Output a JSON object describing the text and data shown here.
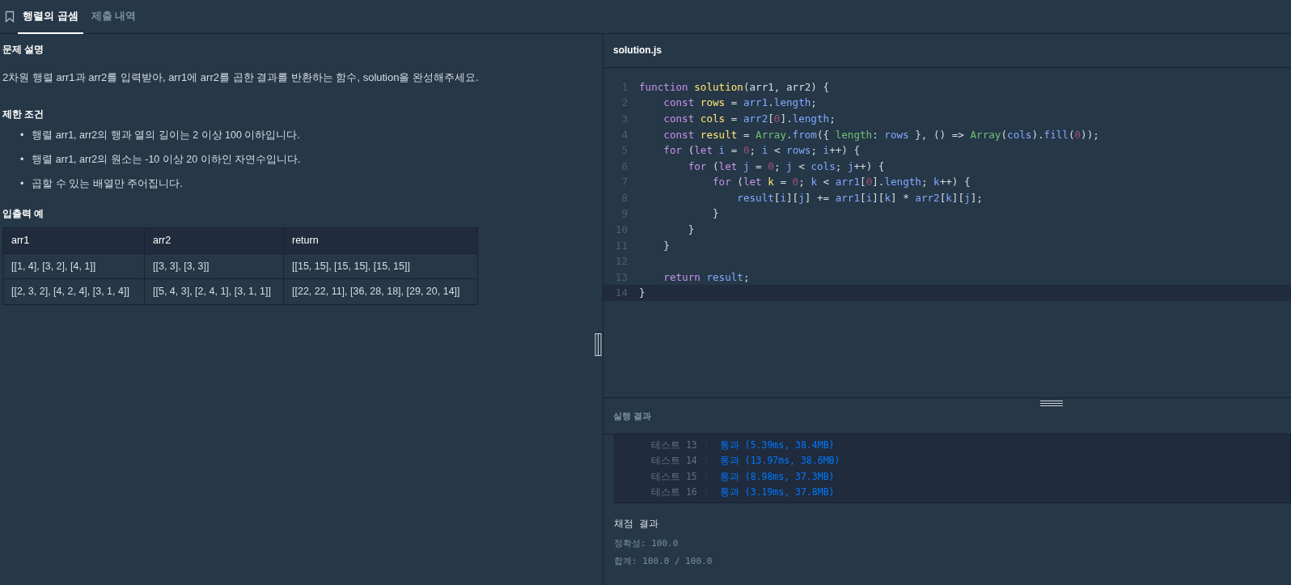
{
  "tabs": [
    {
      "label": "행렬의 곱셈",
      "selected": true
    },
    {
      "label": "제출 내역",
      "selected": false
    }
  ],
  "description": {
    "heading": "문제 설명",
    "text": "2차원 행렬 arr1과 arr2를 입력받아, arr1에 arr2를 곱한 결과를 반환하는 함수, solution을 완성해주세요."
  },
  "constraints": {
    "heading": "제한 조건",
    "items": [
      {
        "marker": "•",
        "text": "행렬 arr1, arr2의 행과 열의 길이는 2 이상 100 이하입니다."
      },
      {
        "marker": "•",
        "text": "행렬 arr1, arr2의 원소는 -10 이상 20 이하인 자연수입니다."
      },
      {
        "marker": "•",
        "text": "곱할 수 있는 배열만 주어집니다."
      }
    ]
  },
  "examples": {
    "heading": "입출력 예",
    "columns": [
      "arr1",
      "arr2",
      "return"
    ],
    "rows": [
      [
        "[[1, 4], [3, 2], [4, 1]]",
        "[[3, 3], [3, 3]]",
        "[[15, 15], [15, 15], [15, 15]]"
      ],
      [
        "[[2, 3, 2], [4, 2, 4], [3, 1, 4]]",
        "[[5, 4, 3], [2, 4, 1], [3, 1, 1]]",
        "[[22, 22, 11], [36, 28, 18], [29, 20, 14]]"
      ]
    ]
  },
  "editor": {
    "filename": "solution.js",
    "lines": [
      {
        "number": "1",
        "current": false,
        "tokens": [
          {
            "kind": "kw",
            "text": "function "
          },
          {
            "kind": "def",
            "text": "solution"
          },
          {
            "kind": "p",
            "text": "(arr1, arr2) {"
          }
        ]
      },
      {
        "number": "2",
        "current": false,
        "tokens": [
          {
            "kind": "kw",
            "text": "    const "
          },
          {
            "kind": "def",
            "text": "rows"
          },
          {
            "kind": "p",
            "text": " = "
          },
          {
            "kind": "var",
            "text": "arr1"
          },
          {
            "kind": "p",
            "text": "."
          },
          {
            "kind": "var",
            "text": "length"
          },
          {
            "kind": "p",
            "text": ";"
          }
        ]
      },
      {
        "number": "3",
        "current": false,
        "tokens": [
          {
            "kind": "kw",
            "text": "    const "
          },
          {
            "kind": "def",
            "text": "cols"
          },
          {
            "kind": "p",
            "text": " = "
          },
          {
            "kind": "var",
            "text": "arr2"
          },
          {
            "kind": "p",
            "text": "["
          },
          {
            "kind": "num",
            "text": "0"
          },
          {
            "kind": "p",
            "text": "]."
          },
          {
            "kind": "var",
            "text": "length"
          },
          {
            "kind": "p",
            "text": ";"
          }
        ]
      },
      {
        "number": "4",
        "current": false,
        "tokens": [
          {
            "kind": "kw",
            "text": "    const "
          },
          {
            "kind": "def",
            "text": "result"
          },
          {
            "kind": "p",
            "text": " = "
          },
          {
            "kind": "cls",
            "text": "Array"
          },
          {
            "kind": "p",
            "text": "."
          },
          {
            "kind": "var",
            "text": "from"
          },
          {
            "kind": "p",
            "text": "({ "
          },
          {
            "kind": "cls",
            "text": "length"
          },
          {
            "kind": "p",
            "text": ": "
          },
          {
            "kind": "var",
            "text": "rows"
          },
          {
            "kind": "p",
            "text": " }, () => "
          },
          {
            "kind": "cls",
            "text": "Array"
          },
          {
            "kind": "p",
            "text": "("
          },
          {
            "kind": "var",
            "text": "cols"
          },
          {
            "kind": "p",
            "text": ")."
          },
          {
            "kind": "var",
            "text": "fill"
          },
          {
            "kind": "p",
            "text": "("
          },
          {
            "kind": "num",
            "text": "0"
          },
          {
            "kind": "p",
            "text": "));"
          }
        ]
      },
      {
        "number": "5",
        "current": false,
        "tokens": [
          {
            "kind": "kw",
            "text": "    for "
          },
          {
            "kind": "p",
            "text": "("
          },
          {
            "kind": "kw",
            "text": "let "
          },
          {
            "kind": "var",
            "text": "i"
          },
          {
            "kind": "p",
            "text": " = "
          },
          {
            "kind": "num",
            "text": "0"
          },
          {
            "kind": "p",
            "text": "; "
          },
          {
            "kind": "var",
            "text": "i"
          },
          {
            "kind": "p",
            "text": " < "
          },
          {
            "kind": "var",
            "text": "rows"
          },
          {
            "kind": "p",
            "text": "; "
          },
          {
            "kind": "var",
            "text": "i"
          },
          {
            "kind": "p",
            "text": "++) {"
          }
        ]
      },
      {
        "number": "6",
        "current": false,
        "tokens": [
          {
            "kind": "kw",
            "text": "        for "
          },
          {
            "kind": "p",
            "text": "("
          },
          {
            "kind": "kw",
            "text": "let "
          },
          {
            "kind": "var",
            "text": "j"
          },
          {
            "kind": "p",
            "text": " = "
          },
          {
            "kind": "num",
            "text": "0"
          },
          {
            "kind": "p",
            "text": "; "
          },
          {
            "kind": "var",
            "text": "j"
          },
          {
            "kind": "p",
            "text": " < "
          },
          {
            "kind": "var",
            "text": "cols"
          },
          {
            "kind": "p",
            "text": "; "
          },
          {
            "kind": "var",
            "text": "j"
          },
          {
            "kind": "p",
            "text": "++) {"
          }
        ]
      },
      {
        "number": "7",
        "current": false,
        "tokens": [
          {
            "kind": "kw",
            "text": "            for "
          },
          {
            "kind": "p",
            "text": "("
          },
          {
            "kind": "kw",
            "text": "let "
          },
          {
            "kind": "def",
            "text": "k"
          },
          {
            "kind": "p",
            "text": " = "
          },
          {
            "kind": "num",
            "text": "0"
          },
          {
            "kind": "p",
            "text": "; "
          },
          {
            "kind": "var",
            "text": "k"
          },
          {
            "kind": "p",
            "text": " < "
          },
          {
            "kind": "var",
            "text": "arr1"
          },
          {
            "kind": "p",
            "text": "["
          },
          {
            "kind": "num",
            "text": "0"
          },
          {
            "kind": "p",
            "text": "]."
          },
          {
            "kind": "var",
            "text": "length"
          },
          {
            "kind": "p",
            "text": "; "
          },
          {
            "kind": "var",
            "text": "k"
          },
          {
            "kind": "p",
            "text": "++) {"
          }
        ]
      },
      {
        "number": "8",
        "current": false,
        "tokens": [
          {
            "kind": "var",
            "text": "                result"
          },
          {
            "kind": "p",
            "text": "["
          },
          {
            "kind": "var",
            "text": "i"
          },
          {
            "kind": "p",
            "text": "]["
          },
          {
            "kind": "var",
            "text": "j"
          },
          {
            "kind": "p",
            "text": "] += "
          },
          {
            "kind": "var",
            "text": "arr1"
          },
          {
            "kind": "p",
            "text": "["
          },
          {
            "kind": "var",
            "text": "i"
          },
          {
            "kind": "p",
            "text": "]["
          },
          {
            "kind": "var",
            "text": "k"
          },
          {
            "kind": "p",
            "text": "] * "
          },
          {
            "kind": "var",
            "text": "arr2"
          },
          {
            "kind": "p",
            "text": "["
          },
          {
            "kind": "var",
            "text": "k"
          },
          {
            "kind": "p",
            "text": "]["
          },
          {
            "kind": "var",
            "text": "j"
          },
          {
            "kind": "p",
            "text": "];"
          }
        ]
      },
      {
        "number": "9",
        "current": false,
        "tokens": [
          {
            "kind": "p",
            "text": "            }"
          }
        ]
      },
      {
        "number": "10",
        "current": false,
        "tokens": [
          {
            "kind": "p",
            "text": "        }"
          }
        ]
      },
      {
        "number": "11",
        "current": false,
        "tokens": [
          {
            "kind": "p",
            "text": "    }"
          }
        ]
      },
      {
        "number": "12",
        "current": false
      },
      {
        "number": "13",
        "current": false,
        "tokens": [
          {
            "kind": "kw",
            "text": "    return "
          },
          {
            "kind": "var",
            "text": "result"
          },
          {
            "kind": "p",
            "text": ";"
          }
        ]
      },
      {
        "number": "14",
        "current": true,
        "tokens": [
          {
            "kind": "p",
            "text": "}"
          }
        ]
      }
    ]
  },
  "results": {
    "heading": "실행 결과",
    "tests": [
      {
        "label": "테스트 13",
        "arrow": "〉",
        "outcome": "통과 (5.39ms, 38.4MB)"
      },
      {
        "label": "테스트 14",
        "arrow": "〉",
        "outcome": "통과 (13.97ms, 38.6MB)"
      },
      {
        "label": "테스트 15",
        "arrow": "〉",
        "outcome": "통과 (8.98ms, 37.3MB)"
      },
      {
        "label": "테스트 16",
        "arrow": "〉",
        "outcome": "통과 (3.19ms, 37.8MB)"
      }
    ],
    "grading": {
      "heading": "채점 결과",
      "lines": [
        "정확성: 100.0",
        "합계: 100.0 / 100.0"
      ]
    }
  }
}
